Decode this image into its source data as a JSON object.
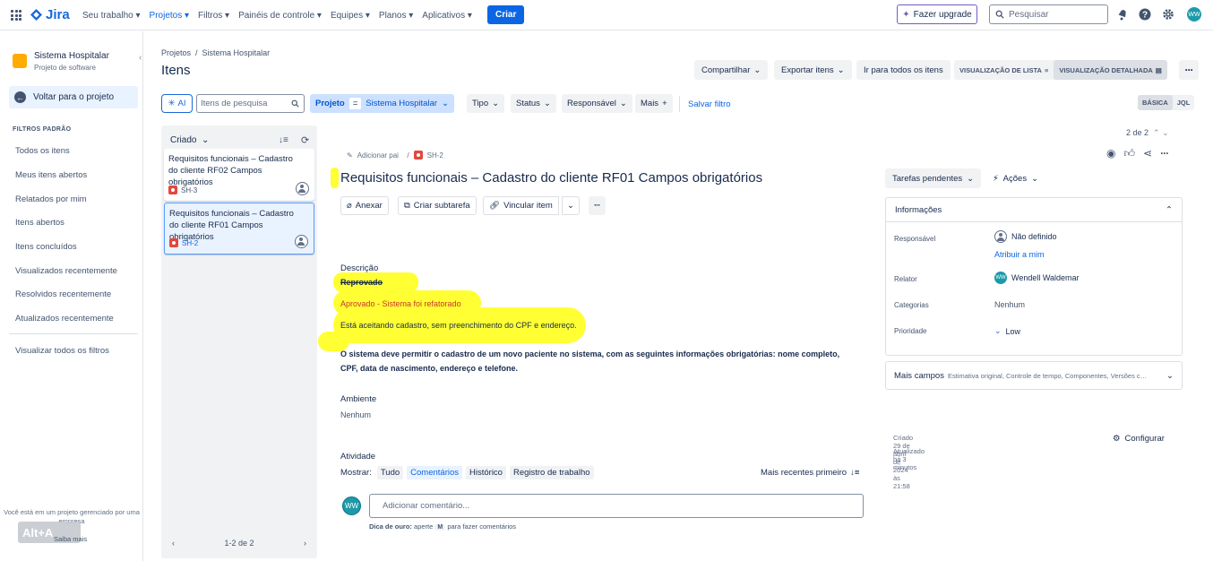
{
  "topbar": {
    "logo": "Jira",
    "nav": [
      "Seu trabalho",
      "Projetos",
      "Filtros",
      "Painéis de controle",
      "Equipes",
      "Planos",
      "Aplicativos"
    ],
    "active_nav": "Projetos",
    "create_label": "Criar",
    "upgrade_label": "Fazer upgrade",
    "search_placeholder": "Pesquisar",
    "avatar_initials": "WW"
  },
  "sidebar": {
    "project_name": "Sistema Hospitalar",
    "project_type": "Projeto de software",
    "back_label": "Voltar para o projeto",
    "section_title": "FILTROS PADRÃO",
    "filters": [
      "Todos os itens",
      "Meus itens abertos",
      "Relatados por mim",
      "Itens abertos",
      "Itens concluídos",
      "Visualizados recentemente",
      "Resolvidos recentemente",
      "Atualizados recentemente"
    ],
    "view_all": "Visualizar todos os filtros",
    "footer_text": "Você está em um projeto gerenciado por uma empresa",
    "learn_more": "Saiba mais",
    "overlay": "Alt+A"
  },
  "header": {
    "breadcrumb": [
      "Projetos",
      "Sistema Hospitalar"
    ],
    "title": "Itens",
    "share": "Compartilhar",
    "export": "Exportar itens",
    "goto_all": "Ir para todos os itens",
    "list_view": "VISUALIZAÇÃO DE LISTA",
    "detail_view": "VISUALIZAÇÃO DETALHADA"
  },
  "filterbar": {
    "ai": "AI",
    "search_placeholder": "Itens de pesquisa",
    "project_label": "Projeto",
    "project_op": "=",
    "project_value": "Sistema Hospitalar",
    "type": "Tipo",
    "status": "Status",
    "assignee": "Responsável",
    "more": "Mais",
    "save": "Salvar filtro",
    "basic": "BÁSICA",
    "jql": "JQL"
  },
  "list": {
    "sort_label": "Criado",
    "items": [
      {
        "title": "Requisitos funcionais – Cadastro do cliente RF02 Campos obrigatórios",
        "key": "SH-3"
      },
      {
        "title": "Requisitos funcionais – Cadastro do cliente RF01 Campos obrigatórios",
        "key": "SH-2"
      }
    ],
    "pager": "1-2 de 2"
  },
  "detail": {
    "counter": "2 de 2",
    "add_parent": "Adicionar pai",
    "key": "SH-2",
    "title": "Requisitos funcionais – Cadastro do cliente RF01 Campos obrigatórios",
    "attach": "Anexar",
    "subtask": "Criar subtarefa",
    "link": "Vincular item",
    "desc_label": "Descrição",
    "desc_rejected": "Reprovado",
    "desc_approved": "Aprovado - Sistema foi refatorado",
    "desc_note": "Está aceitando cadastro, sem preenchimento do CPF e endereço.",
    "desc_body_1": "O sistema deve permitir o cadastro de um novo paciente no sistema, com as seguintes informações obrigatórias: nome completo,",
    "desc_body_2": "CPF, data de nascimento, endereço e telefone.",
    "env_label": "Ambiente",
    "env_value": "Nenhum",
    "activity_label": "Atividade",
    "show_label": "Mostrar:",
    "tabs": [
      "Tudo",
      "Comentários",
      "Histórico",
      "Registro de trabalho"
    ],
    "active_tab": "Comentários",
    "sort_recent": "Mais recentes primeiro",
    "comment_placeholder": "Adicionar comentário...",
    "tip_label": "Dica de ouro:",
    "tip_text_1": "aperte",
    "tip_key": "M",
    "tip_text_2": "para fazer comentários",
    "commenter_initials": "WW"
  },
  "side": {
    "status": "Tarefas pendentes",
    "actions": "Ações",
    "info_title": "Informações",
    "assignee_label": "Responsável",
    "assignee_value": "Não definido",
    "assign_me": "Atribuir a mim",
    "reporter_label": "Relator",
    "reporter_value": "Wendell Waldemar",
    "categories_label": "Categorias",
    "categories_value": "Nenhum",
    "priority_label": "Prioridade",
    "priority_value": "Low",
    "more_fields": "Mais campos",
    "more_fields_hint": "Estimativa original, Controle de tempo, Componentes, Versões c…",
    "created": "Criado 29 de abril de 2024 às 21:58",
    "updated": "Atualizado há 3 minutos",
    "configure": "Configurar"
  },
  "colors": {
    "brand": "#0c66e4",
    "highlight": "#ffff33",
    "approved": "#c9372c"
  }
}
